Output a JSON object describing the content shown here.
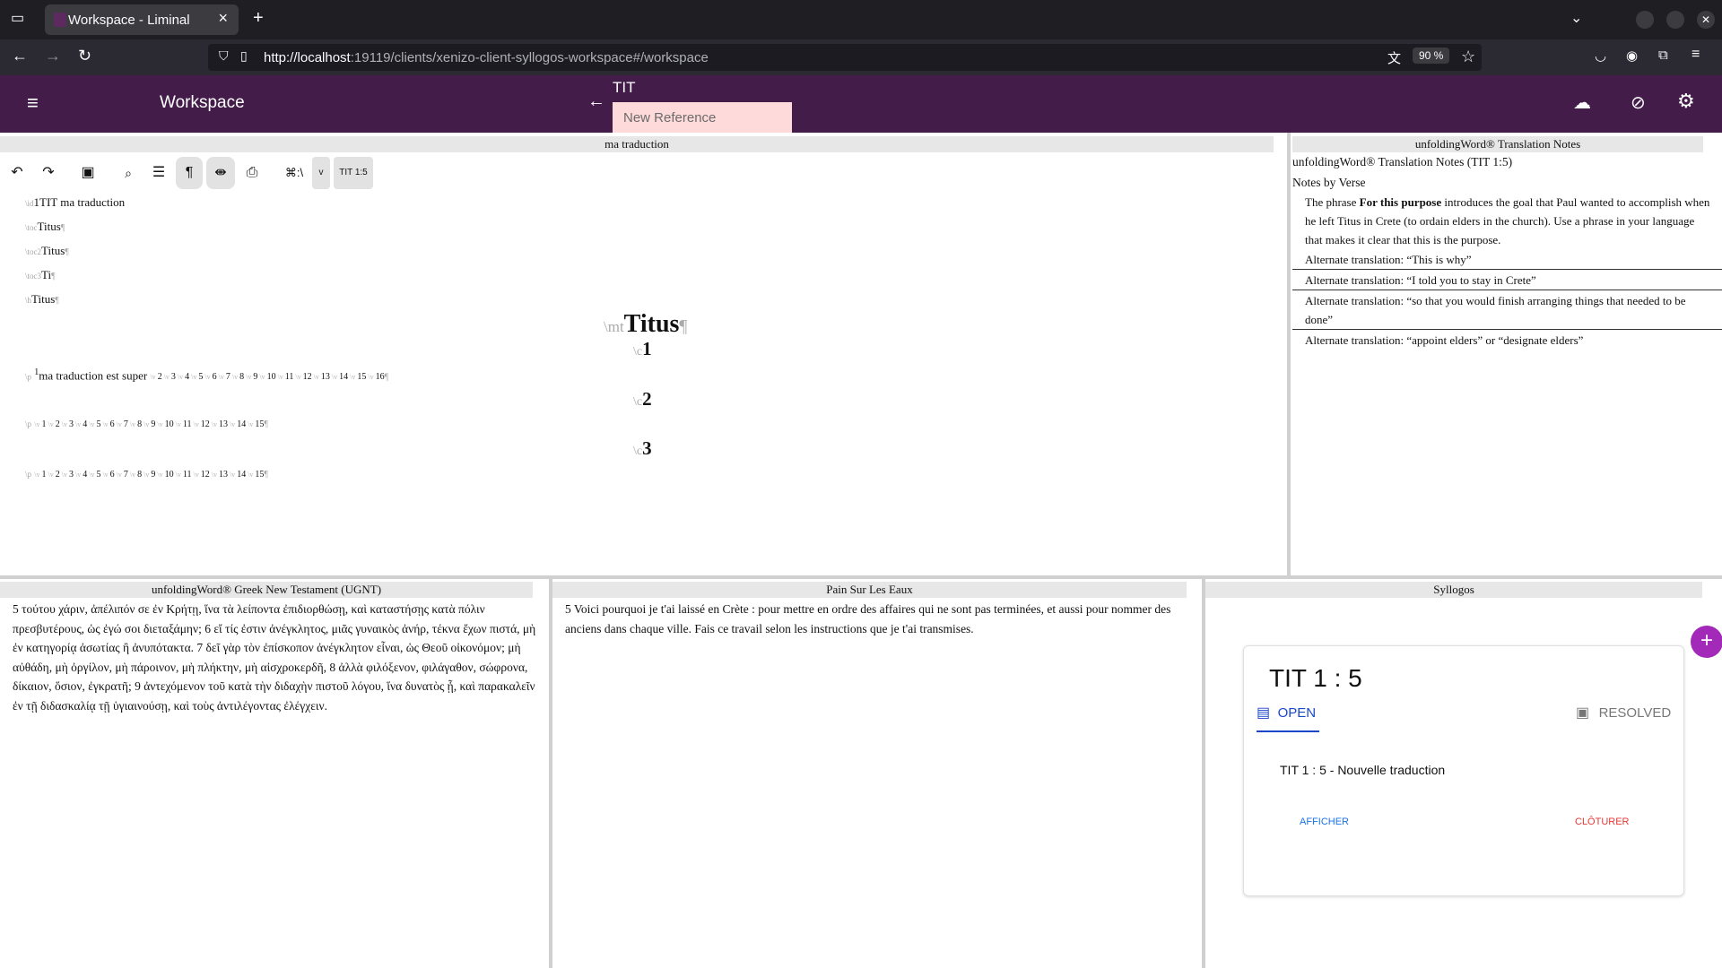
{
  "browser": {
    "tab_title": "Workspace - Liminal",
    "url_host": "http://localhost",
    "url_rest": ":19119/clients/xenizo-client-syllogos-workspace#/workspace",
    "zoom": "90 %"
  },
  "app": {
    "title": "Workspace",
    "book": "TIT",
    "reference_placeholder": "New Reference"
  },
  "editor": {
    "panel_title": "ma traduction",
    "toolbar": {
      "shortcut": "⌘:\\",
      "dropdown": "v",
      "reference": "TIT 1:5"
    },
    "id_line": {
      "marker": "\\id",
      "text": "1TIT ma traduction"
    },
    "headers": [
      {
        "marker": "\\toc",
        "text": "Titus"
      },
      {
        "marker": "\\toc2",
        "text": "Titus"
      },
      {
        "marker": "\\toc3",
        "text": "Ti"
      },
      {
        "marker": "\\h",
        "text": "Titus"
      }
    ],
    "mt": {
      "marker": "\\mt",
      "text": "Titus",
      "pilcrow": "¶"
    },
    "chapters": [
      {
        "marker": "\\c",
        "number": "1",
        "first_verse_text": "ma traduction est super",
        "verses": [
          "1",
          "2",
          "3",
          "4",
          "5",
          "6",
          "7",
          "8",
          "9",
          "10",
          "11",
          "12",
          "13",
          "14",
          "15",
          "16"
        ]
      },
      {
        "marker": "\\c",
        "number": "2",
        "first_verse_text": "",
        "verses": [
          "1",
          "2",
          "3",
          "4",
          "5",
          "6",
          "7",
          "8",
          "9",
          "10",
          "11",
          "12",
          "13",
          "14",
          "15"
        ]
      },
      {
        "marker": "\\c",
        "number": "3",
        "first_verse_text": "",
        "verses": [
          "1",
          "2",
          "3",
          "4",
          "5",
          "6",
          "7",
          "8",
          "9",
          "10",
          "11",
          "12",
          "13",
          "14",
          "15"
        ]
      }
    ]
  },
  "notes": {
    "panel_title": "unfoldingWord® Translation Notes",
    "heading": "unfoldingWord® Translation Notes (TIT 1:5)",
    "subheading": "Notes by Verse",
    "intro_pre": "The phrase ",
    "intro_bold": "For this purpose",
    "intro_post": " introduces the goal that Paul wanted to accomplish when he left Titus in Crete (to ordain elders in the church). Use a phrase in your language that makes it clear that this is the purpose.",
    "alt1": "Alternate translation: “This is why”",
    "alt2": "Alternate translation: “I told you to stay in Crete”",
    "alt3": "Alternate translation: “so that you would finish arranging things that needed to be done”",
    "alt4": "Alternate translation: “appoint elders” or “designate elders”"
  },
  "ugnt": {
    "panel_title": "unfoldingWord® Greek New Testament (UGNT)",
    "text": "5 τούτου χάριν, ἀπέλιπόν σε ἐν Κρήτῃ, ἵνα τὰ λείποντα ἐπιδιορθώσῃ, καὶ καταστήσῃς κατὰ πόλιν πρεσβυτέρους, ὡς ἐγώ σοι διεταξάμην; 6 εἴ τίς ἐστιν ἀνέγκλητος, μιᾶς γυναικὸς ἀνήρ, τέκνα ἔχων πιστά, μὴ ἐν κατηγορίᾳ ἀσωτίας ἢ ἀνυπότακτα. 7 δεῖ γὰρ τὸν ἐπίσκοπον ἀνέγκλητον εἶναι, ὡς Θεοῦ οἰκονόμον; μὴ αὐθάδη, μὴ ὀργίλον, μὴ πάροινον, μὴ πλήκτην, μὴ αἰσχροκερδῆ, 8 ἀλλὰ φιλόξενον, φιλάγαθον, σώφρονα, δίκαιον, ὅσιον, ἐγκρατῆ; 9 ἀντεχόμενον τοῦ κατὰ τὴν διδαχὴν πιστοῦ λόγου, ἵνα δυνατὸς ᾖ, καὶ παρακαλεῖν ἐν τῇ διδασκαλίᾳ τῇ ὑγιαινούσῃ, καὶ τοὺς ἀντιλέγοντας ἐλέγχειν."
  },
  "psle": {
    "panel_title": "Pain Sur Les Eaux",
    "text": "5 Voici pourquoi je t'ai laissé en Crète : pour mettre en ordre des affaires qui ne sont pas terminées, et aussi pour nommer des anciens dans chaque ville. Fais ce travail selon les instructions que je t'ai transmises."
  },
  "syllogos": {
    "panel_title": "Syllogos",
    "card_title": "TIT 1 : 5",
    "tab_open": "OPEN",
    "tab_resolved": "RESOLVED",
    "item_text": "TIT 1 : 5 - Nouvelle traduction",
    "view_button": "AFFICHER",
    "close_button": "CLÔTURER",
    "accent": "#a329b8"
  },
  "icons": [
    "menu-icon",
    "back-arrow-icon",
    "cloud-off-icon",
    "sync-off-icon",
    "settings-icon",
    "undo-icon",
    "redo-icon",
    "save-icon",
    "search-icon",
    "format-icon",
    "pilcrow-icon",
    "split-icon",
    "print-icon",
    "chat-icon",
    "archive-icon",
    "plus-icon"
  ]
}
